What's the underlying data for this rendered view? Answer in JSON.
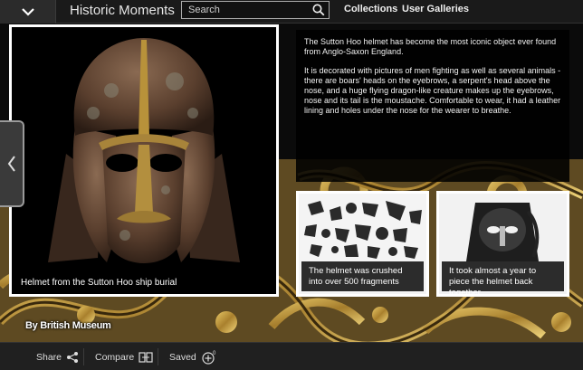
{
  "header": {
    "title": "Historic Moments",
    "search_placeholder": "Search",
    "nav": [
      "Collections",
      "User Galleries"
    ]
  },
  "main_image": {
    "caption": "Helmet from the Sutton Hoo ship burial"
  },
  "description": {
    "paragraphs": [
      "The Sutton Hoo helmet has become the most iconic object ever found from Anglo-Saxon England.",
      "It is decorated with pictures of men fighting as well as several animals - there are boars' heads on the eyebrows, a serpent's head above the nose, and a huge flying dragon-like creature makes up the eyebrows, nose and its tail is the moustache. Comfortable to wear, it had a leather lining and holes under the nose for the wearer to breathe."
    ]
  },
  "cards": [
    {
      "caption": "The helmet was crushed into over 500 fragments"
    },
    {
      "caption": "It took almost a year to piece the helmet back together"
    }
  ],
  "credit": "By British Museum",
  "footer": {
    "share_label": "Share",
    "compare_label": "Compare",
    "saved_label": "Saved",
    "saved_count": "0"
  },
  "colors": {
    "gold": "#c9a243",
    "bar": "#202020",
    "panel": "#000000"
  }
}
